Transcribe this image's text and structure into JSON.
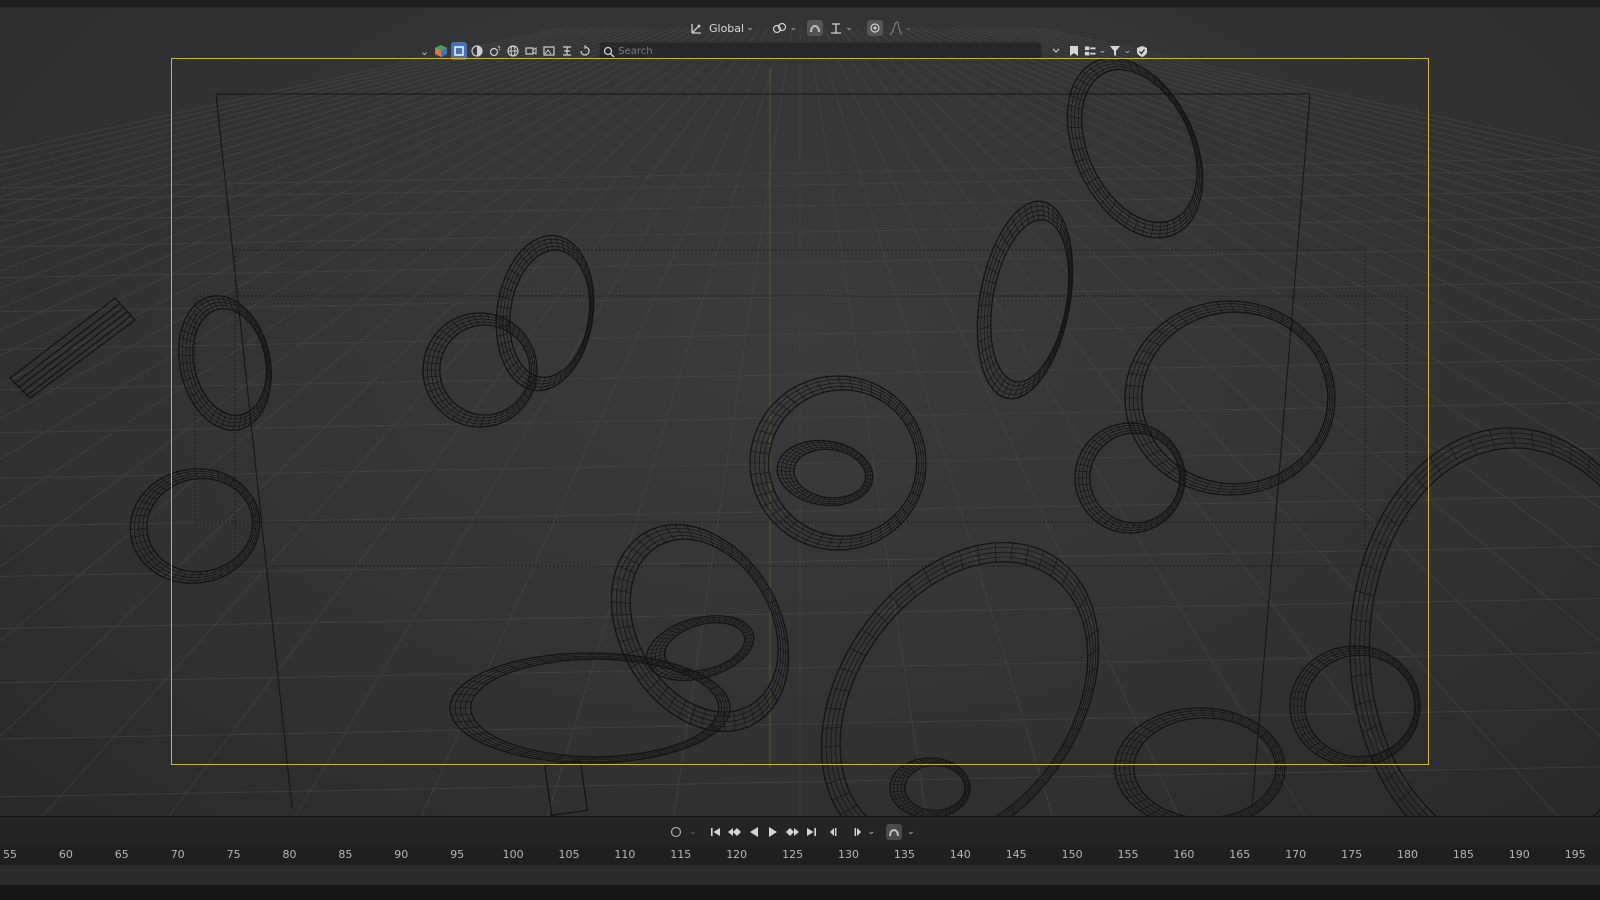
{
  "header": {
    "transform_orientation": "Global",
    "search_placeholder": "Search"
  },
  "icons": {
    "orientation": "transform-orientation-icon",
    "pivot": "pivot-point-icon",
    "snap": "snap-icon",
    "proportional": "proportional-editing-icon",
    "filter": "filter-icon",
    "bookmark": "bookmark-icon",
    "shield": "shield-icon"
  },
  "colors": {
    "camera_frame": "#d6b423",
    "selected_button": "#4772b3",
    "wire": "#141414"
  },
  "timeline": {
    "frame_ticks": [
      "55",
      "60",
      "65",
      "70",
      "75",
      "80",
      "85",
      "90",
      "95",
      "100",
      "105",
      "110",
      "115",
      "120",
      "125",
      "130",
      "135",
      "140",
      "145",
      "150",
      "155",
      "160",
      "165",
      "170",
      "175",
      "180",
      "185",
      "190",
      "195"
    ]
  }
}
